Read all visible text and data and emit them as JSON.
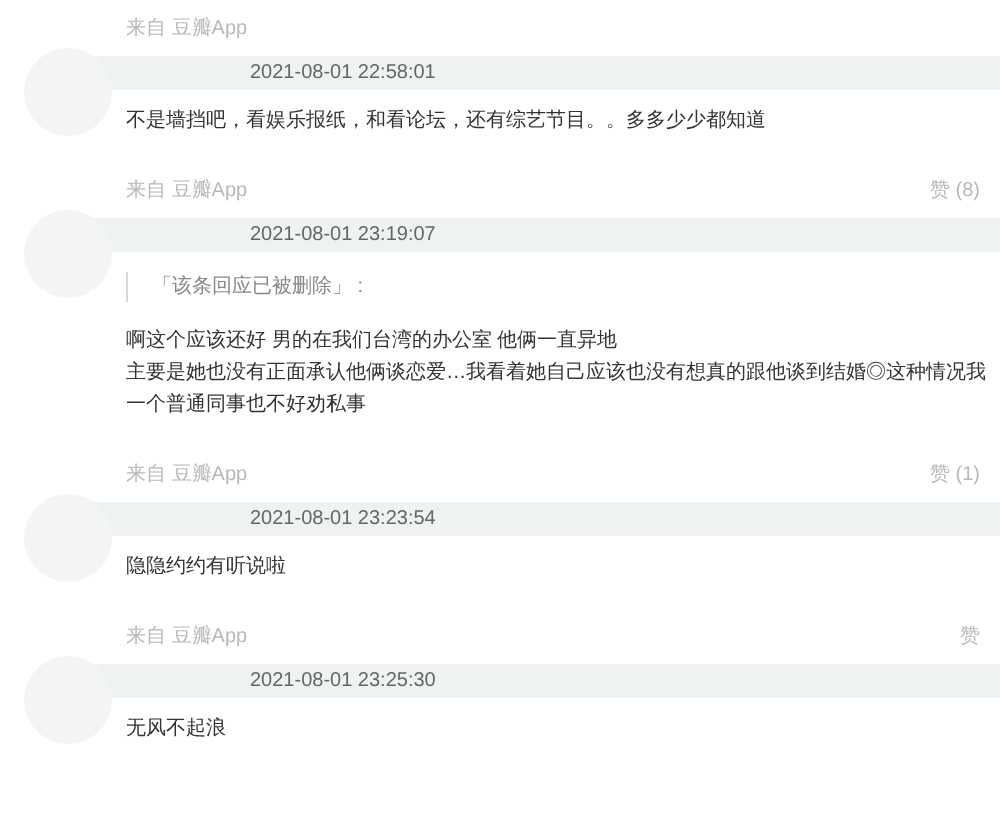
{
  "previous_footer": {
    "source": "来自 豆瓣App"
  },
  "comments": [
    {
      "time": "2021-08-01 22:58:01",
      "lines": [
        "不是墙挡吧，看娱乐报纸，和看论坛，还有综艺节目。。多多少少都知道"
      ],
      "source": "来自 豆瓣App",
      "likes": "赞 (8)"
    },
    {
      "time": "2021-08-01 23:19:07",
      "quote": "「该条回应已被删除」 :",
      "lines": [
        "啊这个应该还好 男的在我们台湾的办公室 他俩一直异地",
        "主要是她也没有正面承认他俩谈恋爱…我看着她自己应该也没有想真的跟他谈到结婚◎这种情况我",
        "一个普通同事也不好劝私事"
      ],
      "source": "来自 豆瓣App",
      "likes": "赞 (1)"
    },
    {
      "time": "2021-08-01 23:23:54",
      "lines": [
        "隐隐约约有听说啦"
      ],
      "source": "来自 豆瓣App",
      "likes": "赞"
    },
    {
      "time": "2021-08-01 23:25:30",
      "lines": [
        "无风不起浪"
      ]
    }
  ]
}
